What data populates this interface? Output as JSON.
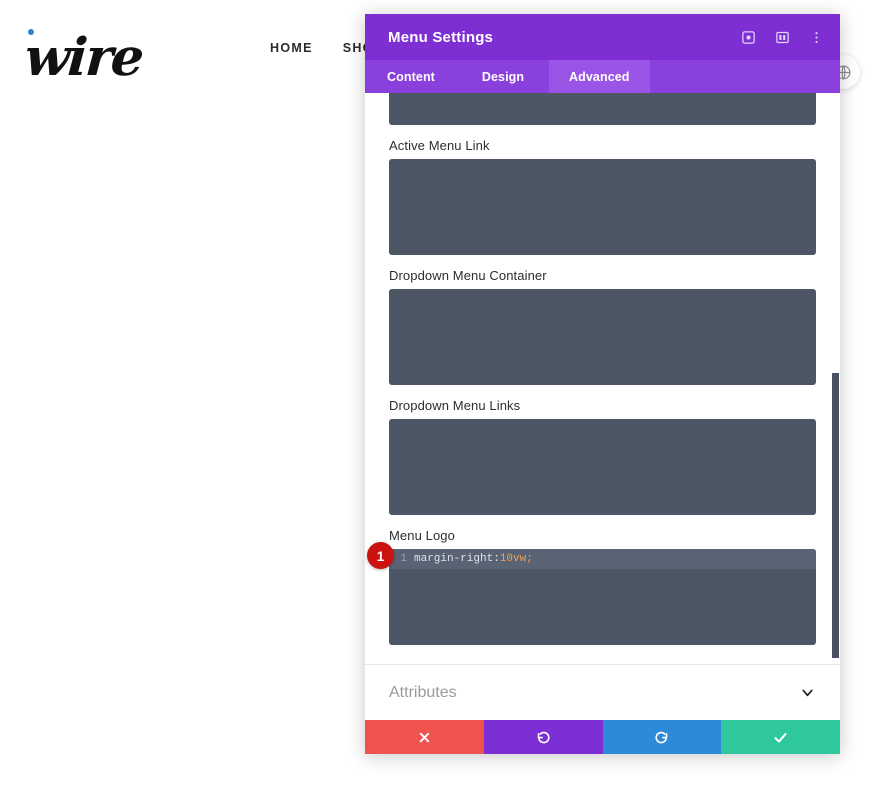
{
  "site": {
    "brand": {
      "wordmark": "wire",
      "dot_color": "#2f7fd6"
    },
    "nav": [
      {
        "label": "HOME"
      },
      {
        "label": "SHOP"
      }
    ],
    "round_button_icon": "globe-icon"
  },
  "modal": {
    "title": "Menu Settings",
    "header_icons": [
      {
        "name": "target-icon"
      },
      {
        "name": "layout-columns-icon"
      },
      {
        "name": "more-vertical-icon"
      }
    ],
    "tabs": [
      {
        "label": "Content",
        "active": false
      },
      {
        "label": "Design",
        "active": false
      },
      {
        "label": "Advanced",
        "active": true
      }
    ],
    "fields": [
      {
        "label": "",
        "clipped": true,
        "code": null
      },
      {
        "label": "Active Menu Link",
        "clipped": false,
        "code": null
      },
      {
        "label": "Dropdown Menu Container",
        "clipped": false,
        "code": null
      },
      {
        "label": "Dropdown Menu Links",
        "clipped": false,
        "code": null
      },
      {
        "label": "Menu Logo",
        "clipped": false,
        "badge": "1",
        "code": {
          "line_number": "1",
          "property": "margin-right:",
          "value": " 10vw",
          "punctuation": ";"
        }
      }
    ],
    "accordion": {
      "label": "Attributes",
      "icon": "chevron-down-icon"
    },
    "actions": [
      {
        "name": "cancel-button",
        "icon": "close-icon",
        "color": "#ef5350"
      },
      {
        "name": "undo-button",
        "icon": "undo-icon",
        "color": "#7b2fd4"
      },
      {
        "name": "redo-button",
        "icon": "redo-icon",
        "color": "#2d8ad8"
      },
      {
        "name": "save-button",
        "icon": "check-icon",
        "color": "#2fc79e"
      }
    ],
    "colors": {
      "header": "#7d2fd4",
      "tabbar": "#8a40dd",
      "tab_active": "#9a55e6",
      "code_bg": "#4d5665",
      "code_line_bg": "#5a6374",
      "badge": "#cc1111"
    }
  }
}
